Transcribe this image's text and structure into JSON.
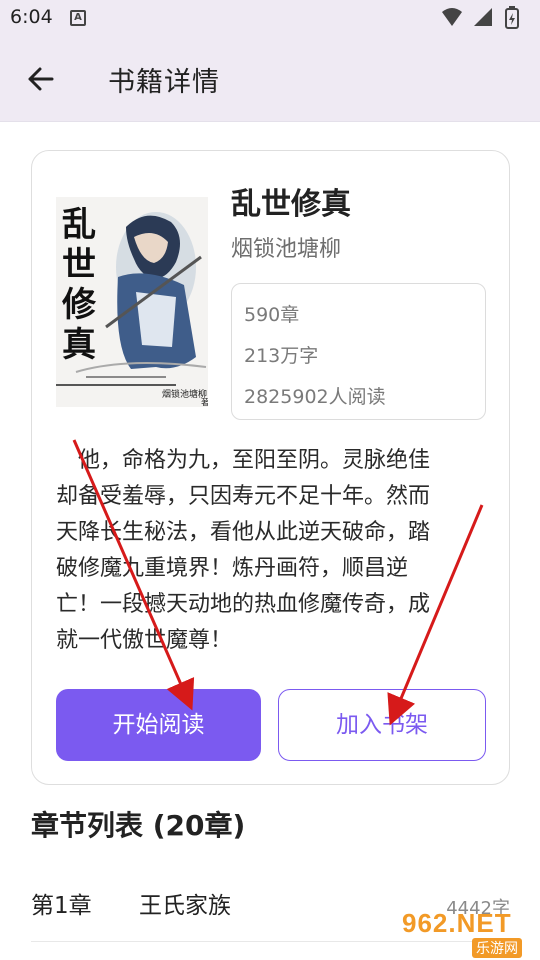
{
  "status_bar": {
    "time": "6:04",
    "notification_letter": "A"
  },
  "app_bar": {
    "title": "书籍详情",
    "back_icon": "arrow-left-icon"
  },
  "book": {
    "cover": {
      "title_chars": [
        "乱",
        "世",
        "修",
        "真"
      ],
      "author": "烟锁池塘柳",
      "by": "著"
    },
    "title": "乱世修真",
    "author": "烟锁池塘柳",
    "stats": {
      "chapters": "590章",
      "words": "213万字",
      "readers": "2825902人阅读"
    },
    "description_lines": [
      "他，命格为九，至阳至阴。灵脉绝佳",
      "却备受羞辱，只因寿元不足十年。然而",
      "天降长生秘法，看他从此逆天破命，踏",
      "破修魔九重境界！炼丹画符，顺昌逆",
      "亡！一段撼天动地的热血修魔传奇，成",
      "就一代傲世魔尊！"
    ],
    "read_button": "开始阅读",
    "shelf_button": "加入书架"
  },
  "chapters": {
    "heading": "章节列表 (20章)",
    "items": [
      {
        "number": "第1章",
        "name": "王氏家族",
        "words": "4442字"
      }
    ]
  },
  "watermark": {
    "big": "962.NET",
    "small": "乐游网"
  },
  "colors": {
    "accent": "#7b5af0",
    "app_bar_bg": "#efeaf3",
    "annotation_red": "#d61a1a"
  }
}
